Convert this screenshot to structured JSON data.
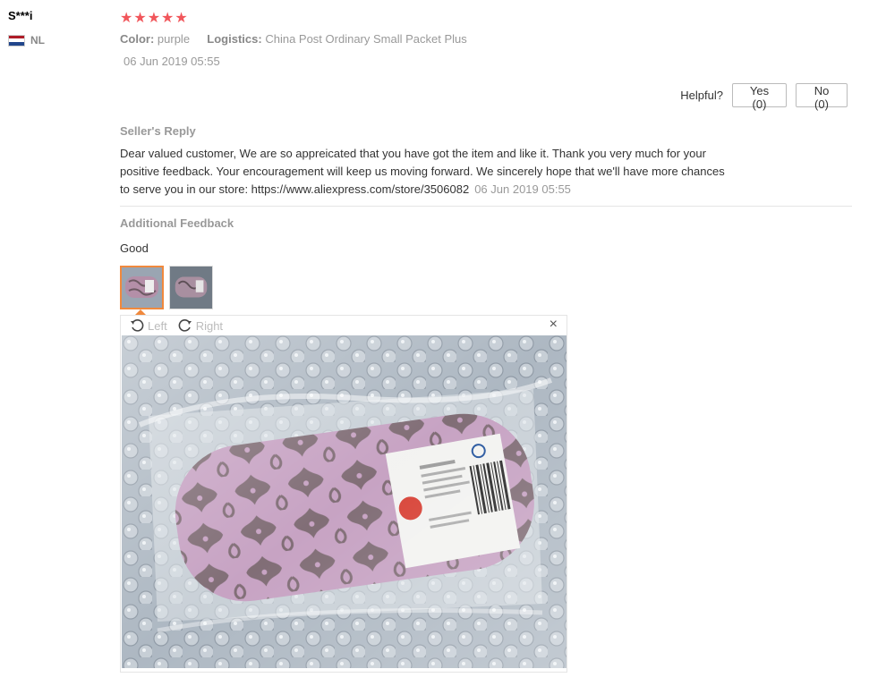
{
  "reviewer": {
    "name": "S***i",
    "country_code": "NL",
    "flag_colors": [
      "#ae1c28",
      "#ffffff",
      "#21468b"
    ]
  },
  "rating": {
    "stars": 5,
    "max": 5,
    "glyphs": "★★★★★",
    "color": "#f1565b"
  },
  "attributes": {
    "color_label": "Color:",
    "color_value": "purple",
    "logistics_label": "Logistics:",
    "logistics_value": "China Post Ordinary Small Packet Plus"
  },
  "review_date": "06 Jun 2019 05:55",
  "helpful": {
    "label": "Helpful?",
    "yes_label": "Yes (0)",
    "no_label": "No (0)"
  },
  "seller_reply": {
    "title": "Seller's Reply",
    "text": "Dear valued customer, We are so appreicated that you have got the item and like it. Thank you very much for your positive feedback. Your encouragement will keep us moving forward. We sincerely hope that we'll have more chances to serve you in our store: https://www.aliexpress.com/store/3506082",
    "date": "06 Jun 2019 05:55"
  },
  "additional_feedback": {
    "title": "Additional Feedback",
    "text": "Good"
  },
  "viewer": {
    "rotate_left_label": "Left",
    "rotate_right_label": "Right",
    "close_glyph": "×",
    "icons": [
      "rotate-left-icon",
      "rotate-right-icon",
      "close-icon"
    ],
    "accent_color": "#f0893d"
  }
}
